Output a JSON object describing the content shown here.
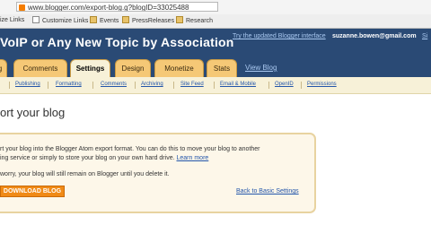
{
  "browser": {
    "url": "www.blogger.com/export-blog.g?blogID=33025488",
    "bookmarks": [
      {
        "label": "ize Links"
      },
      {
        "label": "Customize Links"
      },
      {
        "label": "Events"
      },
      {
        "label": "PressReleases"
      },
      {
        "label": "Research"
      }
    ]
  },
  "header": {
    "blog_title": "VoIP or Any New Topic by Association",
    "try_link": "Try the updated Blogger interface",
    "email": "suzanne.bowen@gmail.com",
    "signout_partial": "Si",
    "view_blog": "View Blog",
    "tabs": [
      {
        "label": "g"
      },
      {
        "label": "Comments"
      },
      {
        "label": "Settings"
      },
      {
        "label": "Design"
      },
      {
        "label": "Monetize"
      },
      {
        "label": "Stats"
      }
    ]
  },
  "subnav": {
    "items": [
      {
        "label": "Publishing"
      },
      {
        "label": "Formatting"
      },
      {
        "label": "Comments"
      },
      {
        "label": "Archiving"
      },
      {
        "label": "Site Feed"
      },
      {
        "label": "Email & Mobile"
      },
      {
        "label": "OpenID"
      },
      {
        "label": "Permissions"
      }
    ]
  },
  "main": {
    "page_title": "ort your blog",
    "line1": "rt your blog into the Blogger Atom export format. You can do this to move your blog to another",
    "line2": "ing service or simply to store your blog on your own hard drive.",
    "learn_more": "Learn more",
    "line3": "worry, your blog will still remain on Blogger until you delete it.",
    "download_button": "DOWNLOAD BLOG",
    "back_link": "Back to Basic Settings"
  }
}
